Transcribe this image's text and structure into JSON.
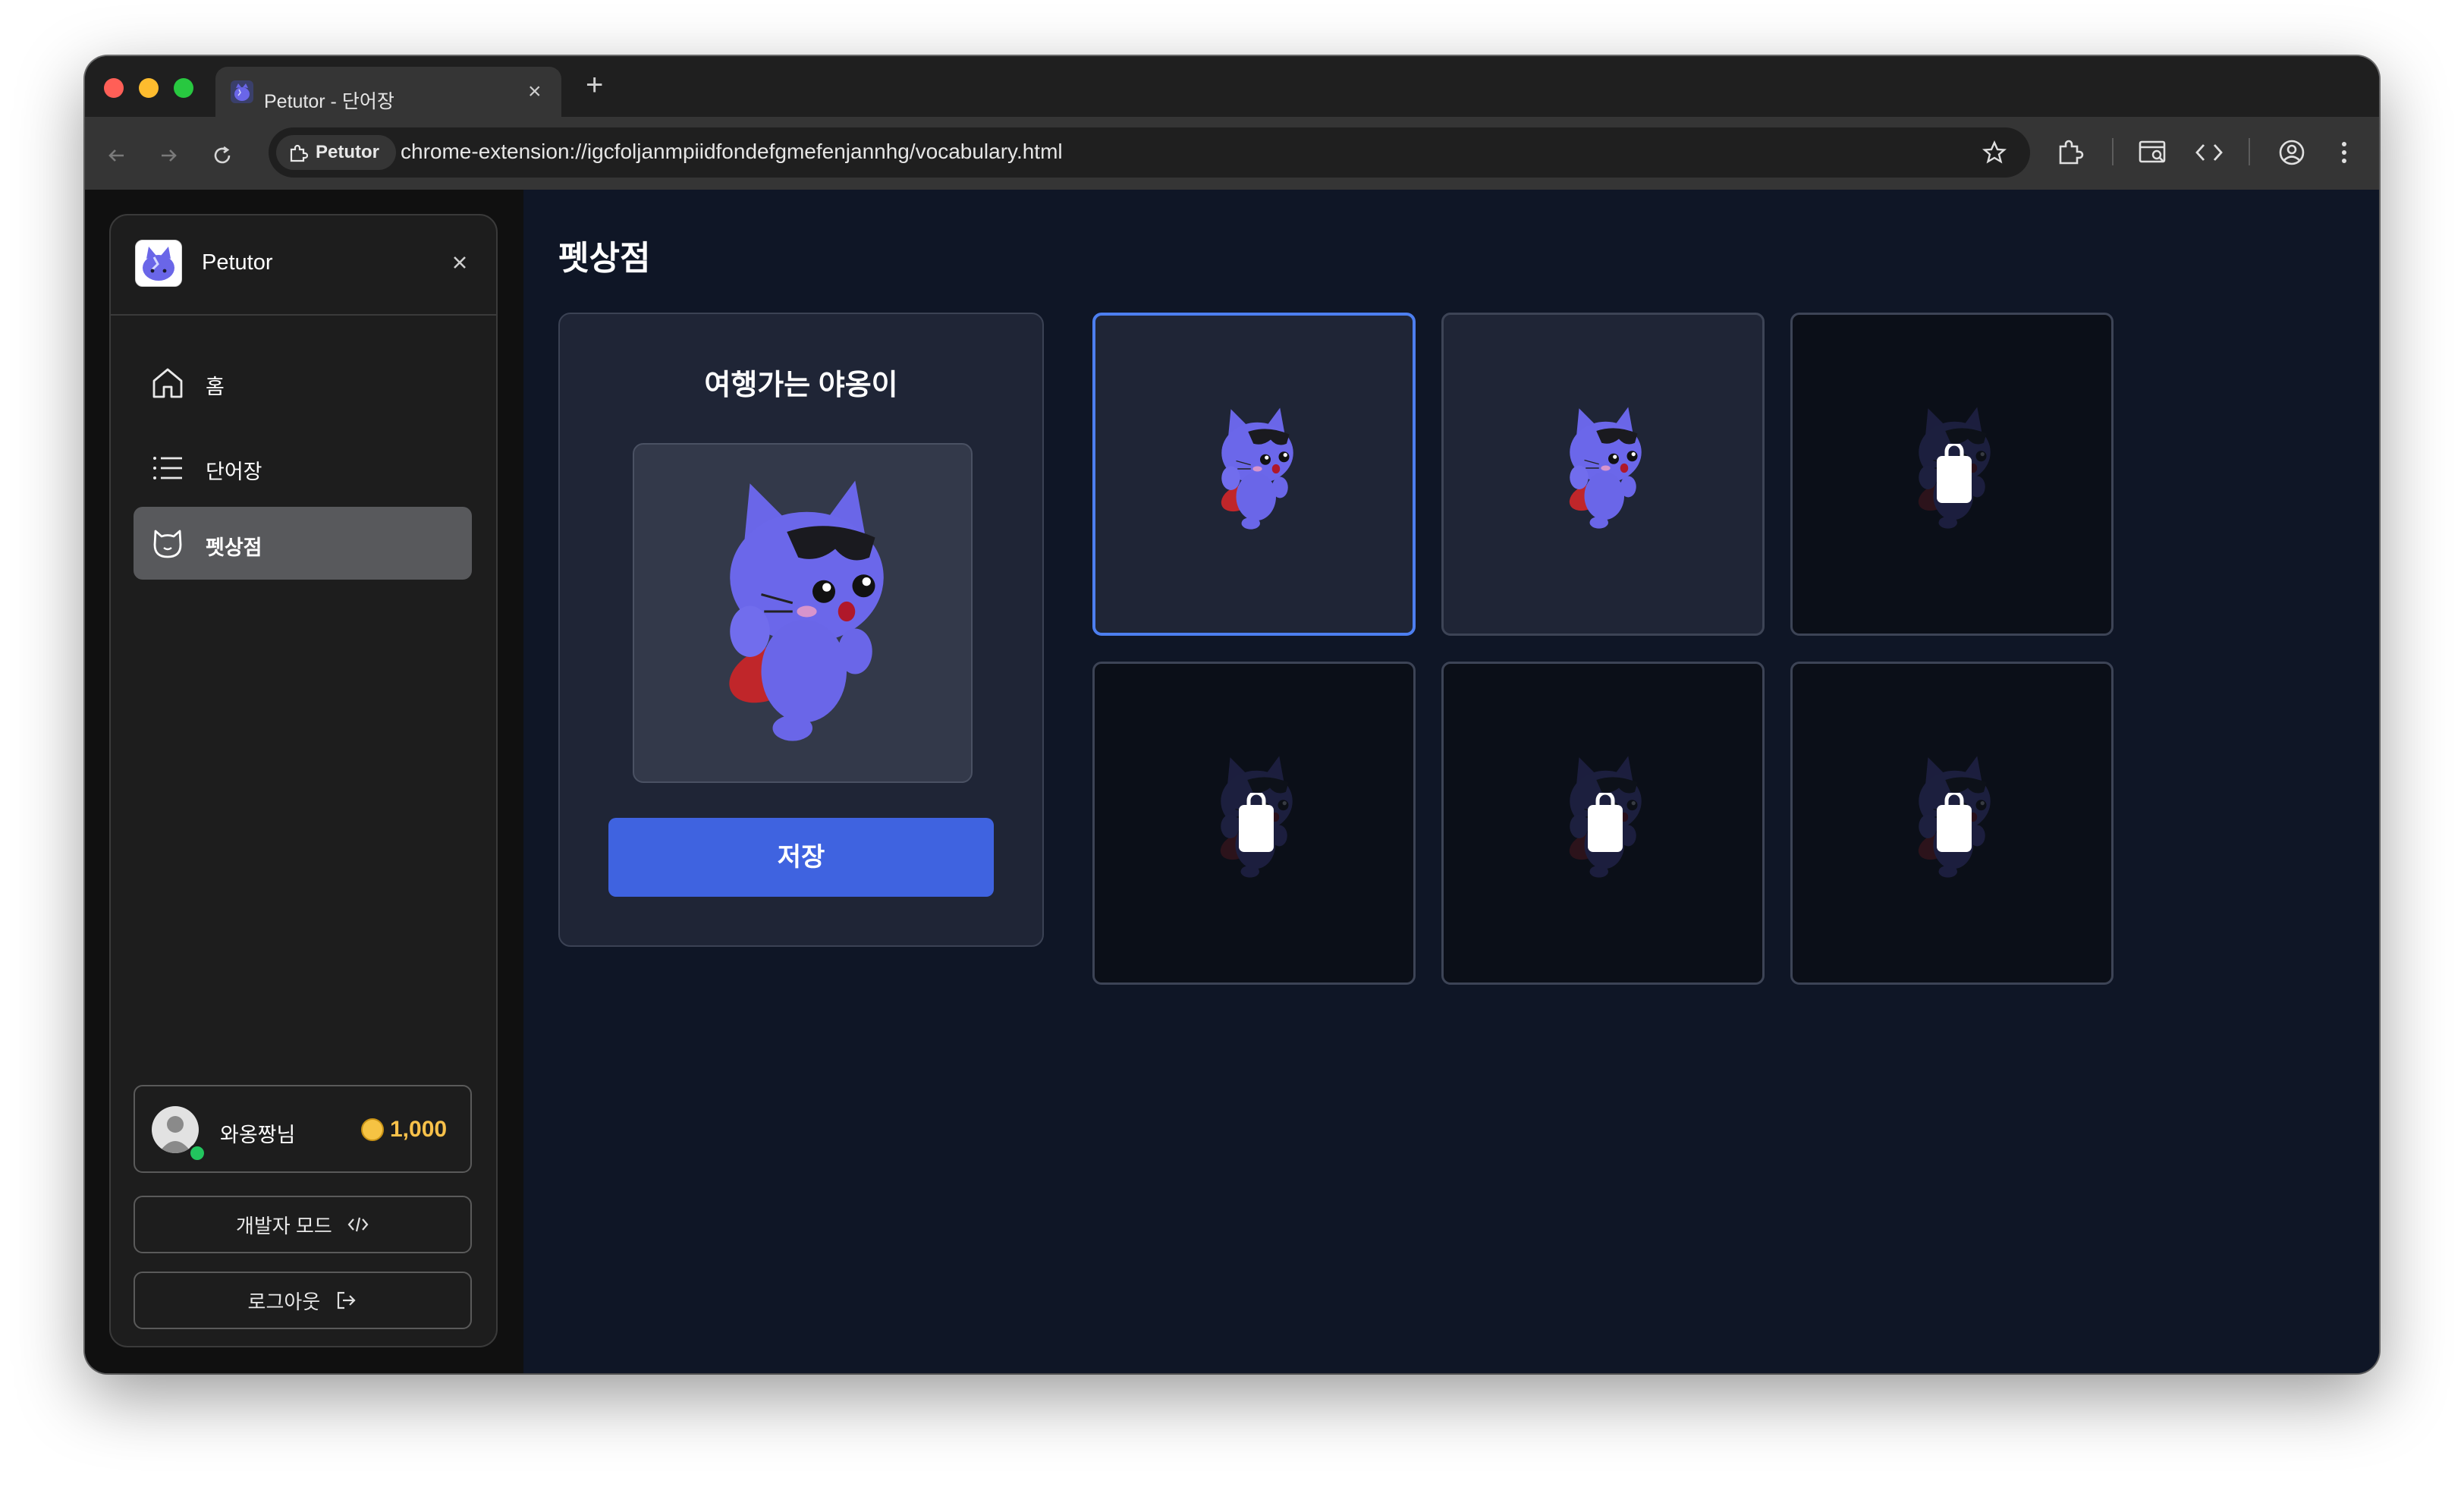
{
  "browser": {
    "tab_title": "Petutor - 단어장",
    "site_chip": "Petutor",
    "url": "chrome-extension://igcfoljanmpiidfondefgmefenjannhg/vocabulary.html"
  },
  "sidebar": {
    "app_name": "Petutor",
    "items": [
      {
        "label": "홈",
        "icon": "home-icon",
        "active": false
      },
      {
        "label": "단어장",
        "icon": "list-icon",
        "active": false
      },
      {
        "label": "펫상점",
        "icon": "cat-icon",
        "active": true
      }
    ],
    "user": {
      "name": "와옹짱님",
      "coins": "1,000",
      "online": true
    },
    "developer_mode_label": "개발자 모드",
    "logout_label": "로그아웃"
  },
  "main": {
    "title": "펫상점",
    "preview": {
      "pet_name": "여행가는 야옹이",
      "save_label": "저장"
    },
    "grid": [
      {
        "status": "selected"
      },
      {
        "status": "owned"
      },
      {
        "status": "locked"
      },
      {
        "status": "locked"
      },
      {
        "status": "locked"
      },
      {
        "status": "locked"
      }
    ]
  },
  "colors": {
    "accent": "#3f63e0",
    "selected_border": "#4d7ff0",
    "coin": "#f6c343",
    "page_bg": "#0f1626",
    "pet": "#6a66e8"
  }
}
